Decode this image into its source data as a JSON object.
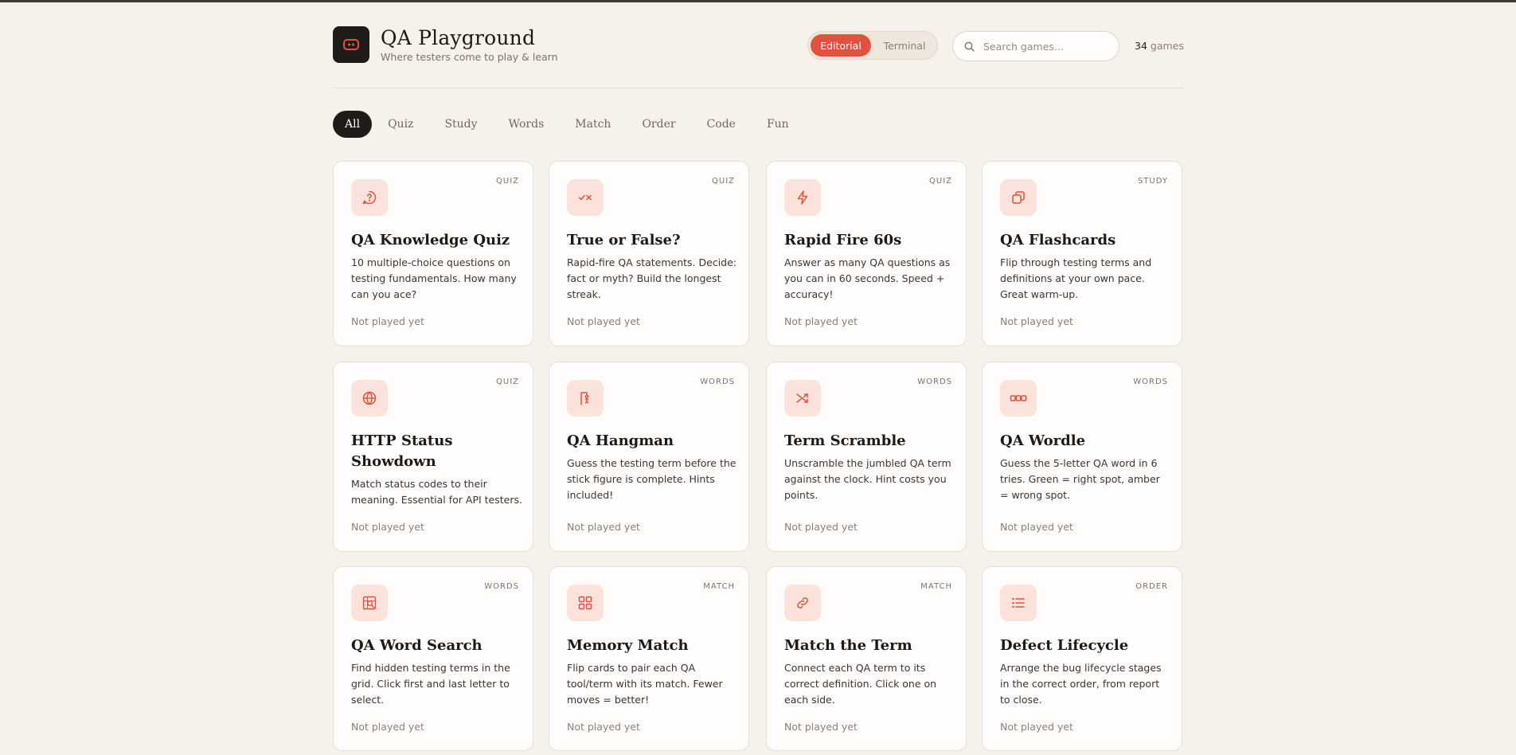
{
  "app": {
    "title": "QA Playground",
    "subtitle": "Where testers come to play & learn"
  },
  "theme": {
    "options": [
      "Editorial",
      "Terminal"
    ],
    "selected": "Editorial",
    "accent": "#e2513e"
  },
  "search": {
    "placeholder": "Search games...",
    "value": ""
  },
  "count": {
    "number": "34",
    "label": "games"
  },
  "filters": [
    "All",
    "Quiz",
    "Study",
    "Words",
    "Match",
    "Order",
    "Code",
    "Fun"
  ],
  "active_filter": "All",
  "games": [
    {
      "icon": "question-bubble-icon",
      "tag": "QUIZ",
      "title": "QA Knowledge Quiz",
      "desc": "10 multiple-choice questions on testing fundamentals. How many can you ace?",
      "status": "Not played yet"
    },
    {
      "icon": "check-cross-icon",
      "tag": "QUIZ",
      "title": "True or False?",
      "desc": "Rapid-fire QA statements. Decide: fact or myth? Build the longest streak.",
      "status": "Not played yet"
    },
    {
      "icon": "lightning-icon",
      "tag": "QUIZ",
      "title": "Rapid Fire 60s",
      "desc": "Answer as many QA questions as you can in 60 seconds. Speed + accuracy!",
      "status": "Not played yet"
    },
    {
      "icon": "cards-icon",
      "tag": "STUDY",
      "title": "QA Flashcards",
      "desc": "Flip through testing terms and definitions at your own pace. Great warm-up.",
      "status": "Not played yet"
    },
    {
      "icon": "globe-icon",
      "tag": "QUIZ",
      "title": "HTTP Status Showdown",
      "desc": "Match status codes to their meaning. Essential for API testers.",
      "status": "Not played yet"
    },
    {
      "icon": "gallows-icon",
      "tag": "WORDS",
      "title": "QA Hangman",
      "desc": "Guess the testing term before the stick figure is complete. Hints included!",
      "status": "Not played yet"
    },
    {
      "icon": "shuffle-icon",
      "tag": "WORDS",
      "title": "Term Scramble",
      "desc": "Unscramble the jumbled QA term against the clock. Hint costs you points.",
      "status": "Not played yet"
    },
    {
      "icon": "letter-tiles-icon",
      "tag": "WORDS",
      "title": "QA Wordle",
      "desc": "Guess the 5-letter QA word in 6 tries. Green = right spot, amber = wrong spot.",
      "status": "Not played yet"
    },
    {
      "icon": "grid-search-icon",
      "tag": "WORDS",
      "title": "QA Word Search",
      "desc": "Find hidden testing terms in the grid. Click first and last letter to select.",
      "status": "Not played yet"
    },
    {
      "icon": "grid-icon",
      "tag": "MATCH",
      "title": "Memory Match",
      "desc": "Flip cards to pair each QA tool/term with its match. Fewer moves = better!",
      "status": "Not played yet"
    },
    {
      "icon": "link-icon",
      "tag": "MATCH",
      "title": "Match the Term",
      "desc": "Connect each QA term to its correct definition. Click one on each side.",
      "status": "Not played yet"
    },
    {
      "icon": "list-icon",
      "tag": "ORDER",
      "title": "Defect Lifecycle",
      "desc": "Arrange the bug lifecycle stages in the correct order, from report to close.",
      "status": "Not played yet"
    }
  ]
}
